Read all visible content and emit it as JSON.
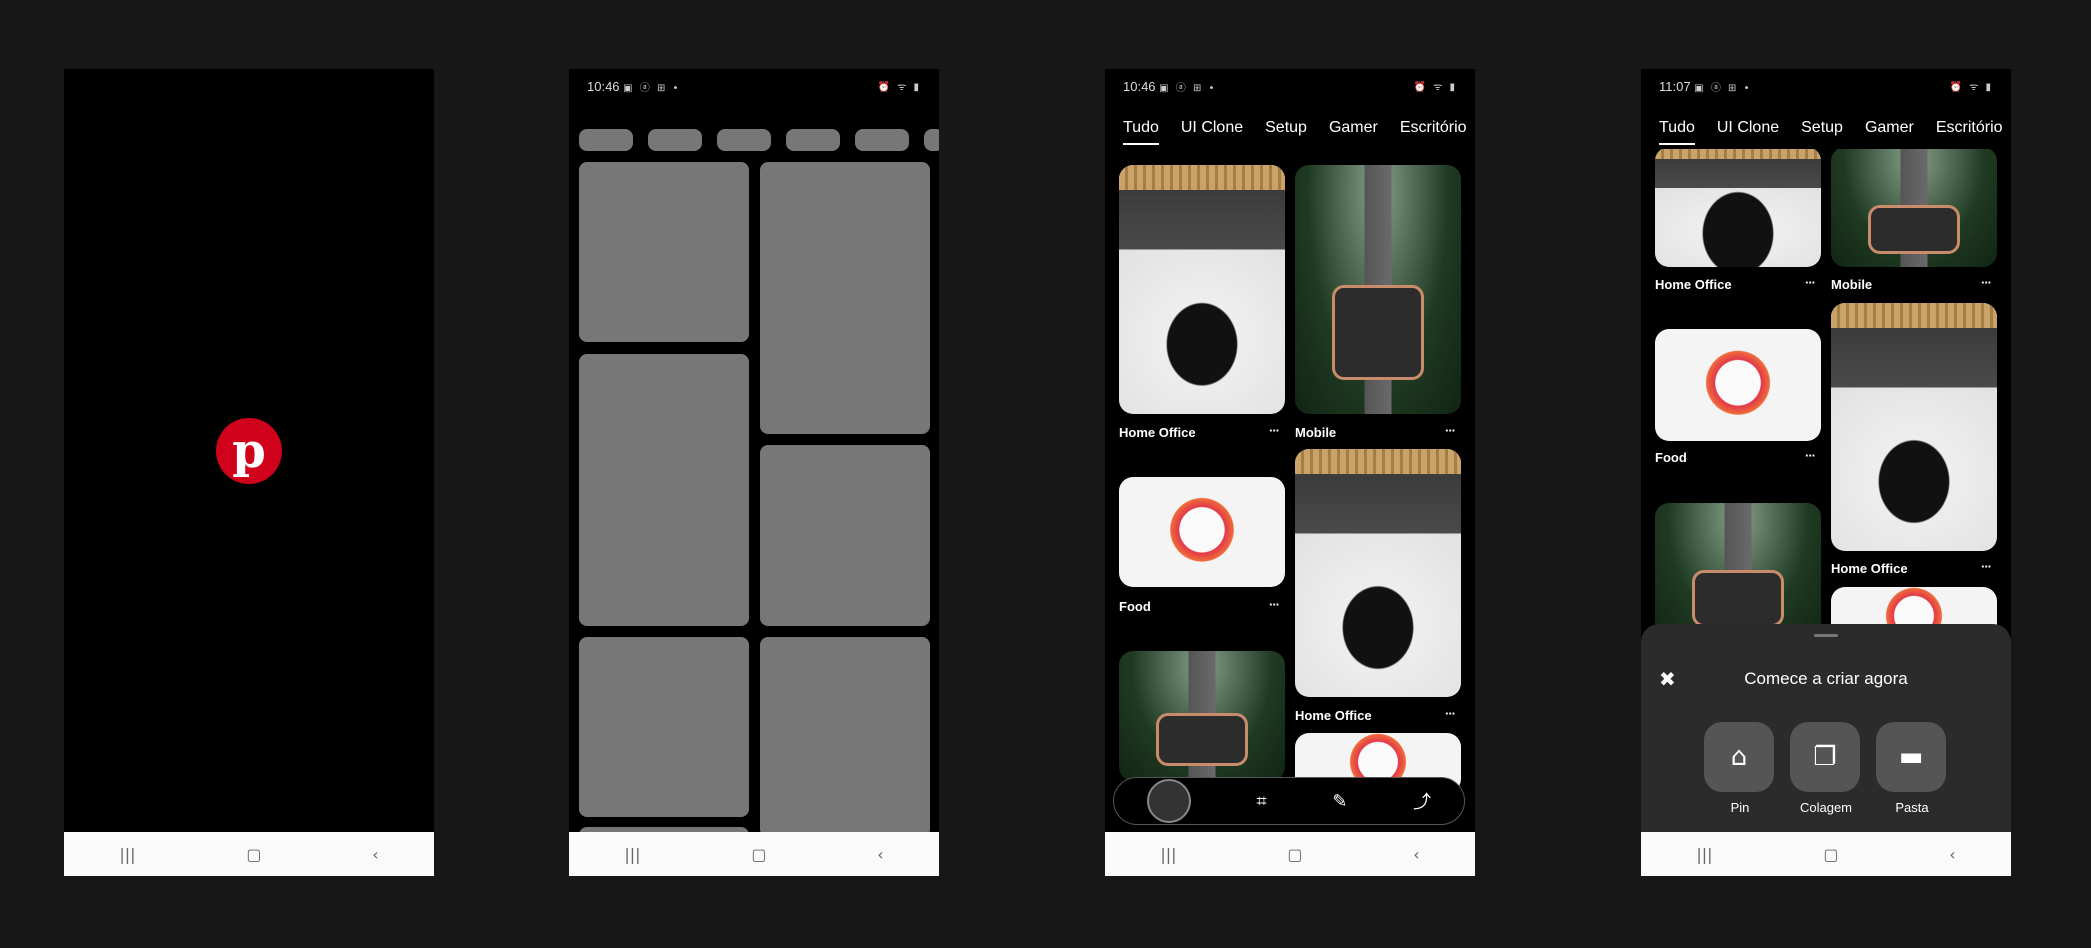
{
  "status": {
    "time_p2": "10:46",
    "time_p3": "10:46",
    "time_p4": "11:07",
    "left_icons": "▣ ⓐ ⊞ •",
    "right_icons": "⏰ ᯤ ▮"
  },
  "splash": {
    "logo": "p"
  },
  "tabs": [
    "Tudo",
    "UI Clone",
    "Setup",
    "Gamer",
    "Escritório"
  ],
  "feed": {
    "home_office": "Home Office",
    "mobile": "Mobile",
    "food": "Food",
    "more": "···"
  },
  "action_bar": {
    "scan": "⌗",
    "edit": "✎",
    "share": "⤴"
  },
  "sheet": {
    "title": "Comece a criar agora",
    "close": "✖",
    "options": [
      {
        "label": "Pin",
        "icon": "home-icon",
        "glyph": "⌂"
      },
      {
        "label": "Colagem",
        "icon": "collage-icon",
        "glyph": "❐"
      },
      {
        "label": "Pasta",
        "icon": "folder-icon",
        "glyph": "▬"
      }
    ]
  },
  "nav": {
    "recents": "|||",
    "home": "▢",
    "back": "‹"
  }
}
